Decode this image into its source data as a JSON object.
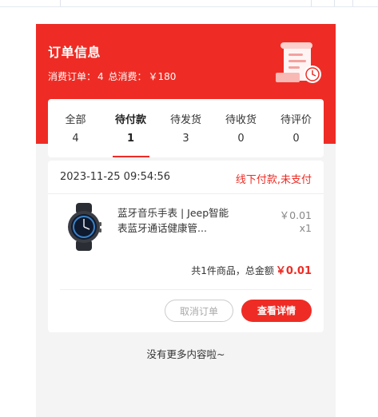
{
  "header": {
    "title": "订单信息",
    "orders_label": "消费订单：",
    "orders_count": "4",
    "total_label": "总消费：",
    "total_amount": "￥180",
    "icon": "receipt-icon"
  },
  "tabs": [
    {
      "label": "全部",
      "count": "4",
      "active": false
    },
    {
      "label": "待付款",
      "count": "1",
      "active": true
    },
    {
      "label": "待发货",
      "count": "3",
      "active": false
    },
    {
      "label": "待收货",
      "count": "0",
      "active": false
    },
    {
      "label": "待评价",
      "count": "0",
      "active": false
    }
  ],
  "order": {
    "datetime": "2023-11-25 09:54:56",
    "status": "线下付款,未支付",
    "product": {
      "name": "蓝牙音乐手表 | Jeep智能表蓝牙通话健康管...",
      "price": "￥0.01",
      "quantity": "x1",
      "image": "smartwatch-image"
    },
    "summary_text": "共1件商品，总金额",
    "summary_amount": "￥0.01",
    "cancel_label": "取消订单",
    "detail_label": "查看详情"
  },
  "footer": {
    "no_more": "没有更多内容啦~"
  },
  "colors": {
    "accent": "#ee2c25",
    "background": "#f4f4f4"
  }
}
